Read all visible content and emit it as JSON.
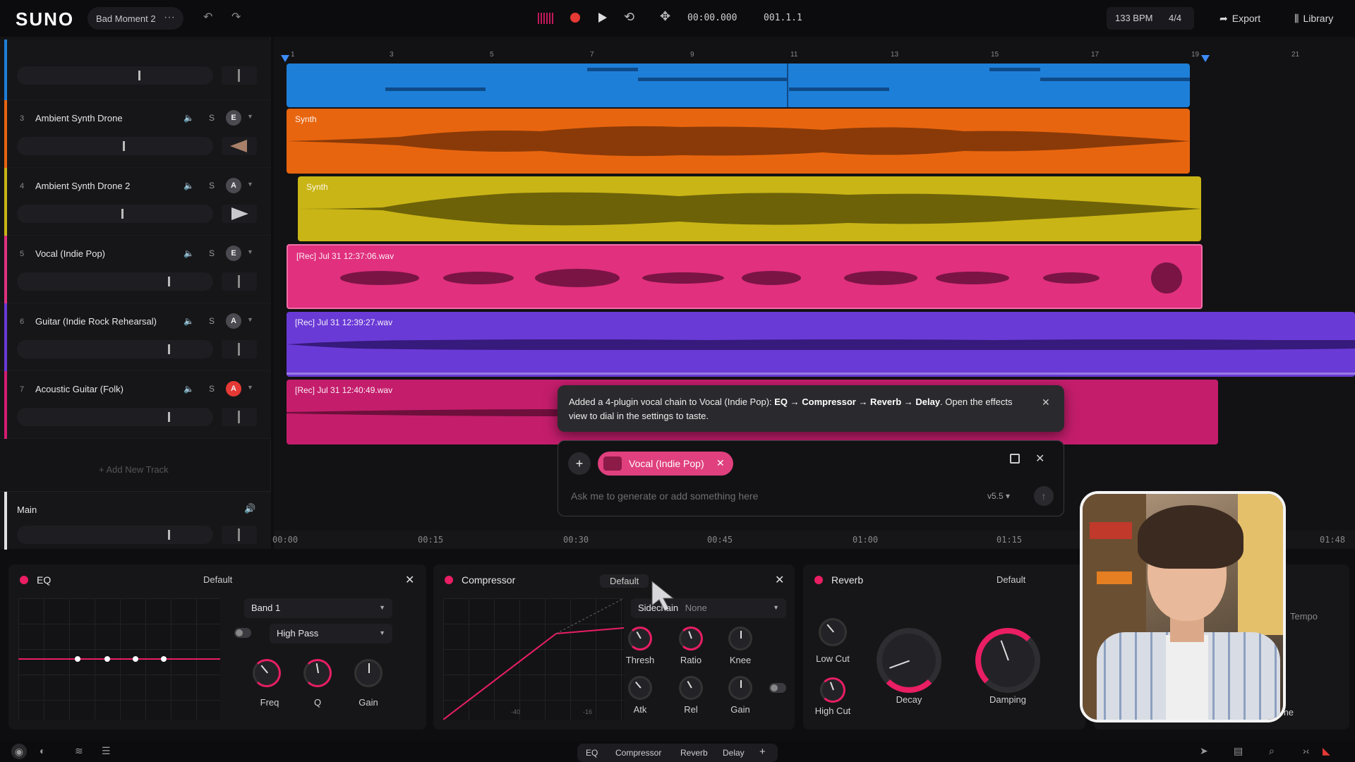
{
  "app": {
    "logo": "SUNO",
    "project_name": "Bad Moment 2",
    "more": "···"
  },
  "transport": {
    "time": "00:00.000",
    "bars": "001.1.1",
    "bpm": "133 BPM",
    "time_signature": "4/4",
    "export_label": "Export",
    "library_label": "Library"
  },
  "tracks": [
    {
      "num": "3",
      "name": "Ambient Synth Drone",
      "badge": "E",
      "color": "#e8650f"
    },
    {
      "num": "4",
      "name": "Ambient Synth Drone 2",
      "badge": "A",
      "color": "#c9b516"
    },
    {
      "num": "5",
      "name": "Vocal (Indie Pop)",
      "badge": "E",
      "color": "#e0307e"
    },
    {
      "num": "6",
      "name": "Guitar (Indie Rock Rehearsal)",
      "badge": "A",
      "color": "#6a3ad6"
    },
    {
      "num": "7",
      "name": "Acoustic Guitar (Folk)",
      "badge": "A",
      "color": "#d41d72"
    }
  ],
  "track_controls": {
    "solo": "S"
  },
  "add_track_label": "Add New Track",
  "main_track": {
    "name": "Main"
  },
  "ruler": {
    "bars": [
      "1",
      "3",
      "5",
      "7",
      "9",
      "11",
      "13",
      "15",
      "17",
      "19",
      "21"
    ]
  },
  "clips": {
    "synth1": "Synth",
    "synth2": "Synth",
    "vocal": "[Rec] Jul 31 12:37:06.wav",
    "guitar": "[Rec] Jul 31 12:39:27.wav",
    "acoustic": "[Rec] Jul 31 12:40:49.wav"
  },
  "bottom_ruler": [
    "00:00",
    "00:15",
    "00:30",
    "00:45",
    "01:00",
    "01:15",
    "01:48"
  ],
  "notification": {
    "prefix": "Added a 4-plugin vocal chain to Vocal (Indie Pop): ",
    "chain": "EQ → Compressor → Reverb → Delay",
    "suffix": ". Open the effects view to dial in the settings to taste."
  },
  "composer": {
    "chip_label": "Vocal (Indie Pop)",
    "placeholder": "Ask me to generate or add something here",
    "version": "v5.5"
  },
  "fx": {
    "eq": {
      "title": "EQ",
      "preset": "Default",
      "band": "Band 1",
      "filter": "High Pass",
      "knobs": [
        "Freq",
        "Q",
        "Gain"
      ]
    },
    "compressor": {
      "title": "Compressor",
      "preset": "Default",
      "sidechain": "Sidechain",
      "sidechain_value": "None",
      "knobs_top": [
        "Thresh",
        "Ratio",
        "Knee"
      ],
      "knobs_bottom": [
        "Atk",
        "Rel",
        "Gain"
      ],
      "axis": [
        "-40",
        "-16"
      ]
    },
    "reverb": {
      "title": "Reverb",
      "preset": "Default",
      "knobs": [
        "Low Cut",
        "High Cut",
        "Decay",
        "Damping"
      ]
    },
    "delay": {
      "tempo": "Tempo",
      "time": "me"
    }
  },
  "fx_tabs": [
    "EQ",
    "Compressor",
    "Reverb",
    "Delay",
    "+"
  ]
}
